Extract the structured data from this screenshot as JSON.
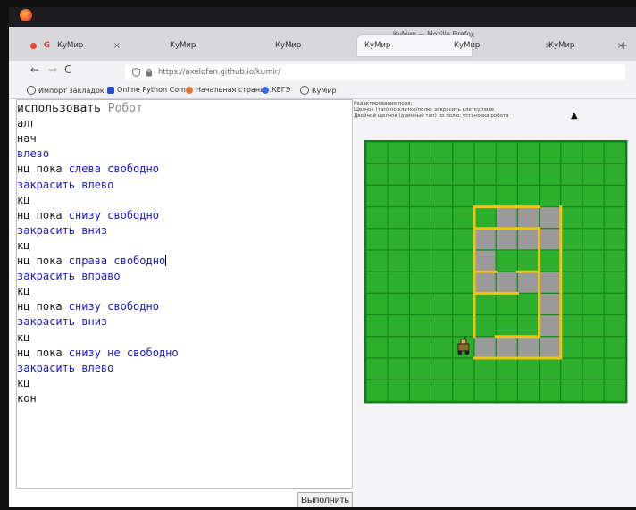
{
  "browser": {
    "window_title": "КуМир — Mozilla Firefox",
    "tabs": [
      {
        "g": "G",
        "label": "КуМир",
        "close": "×"
      },
      {
        "label": "КуМир",
        "close": "×"
      },
      {
        "label": "КуМир",
        "close": "×"
      },
      {
        "label": "КуМир",
        "close": ""
      },
      {
        "label": "КуМир",
        "close": "×"
      },
      {
        "label": "КуМир",
        "close": "×"
      }
    ],
    "new_tab": "+",
    "nav": {
      "back": "←",
      "forward": "→",
      "reload": "C"
    },
    "url": "https://axelofan.github.io/kumir/",
    "bookmarks": [
      "Импорт закладок...",
      "Online Python Com...",
      "Начальная страни...",
      "КЕГЭ",
      "КуМир"
    ]
  },
  "editor": {
    "lines": [
      [
        {
          "t": "использовать ",
          "c": "k"
        },
        {
          "t": "Робот",
          "c": "g"
        }
      ],
      [
        {
          "t": "алг",
          "c": "k"
        }
      ],
      [
        {
          "t": "нач",
          "c": "k"
        }
      ],
      [
        {
          "t": "влево",
          "c": "b"
        }
      ],
      [
        {
          "t": "нц пока ",
          "c": "k"
        },
        {
          "t": "слева свободно",
          "c": "b"
        }
      ],
      [
        {
          "t": "закрасить влево",
          "c": "b"
        }
      ],
      [
        {
          "t": "кц",
          "c": "k"
        }
      ],
      [
        {
          "t": "нц пока ",
          "c": "k"
        },
        {
          "t": "снизу свободно",
          "c": "b"
        }
      ],
      [
        {
          "t": "закрасить вниз",
          "c": "b"
        }
      ],
      [
        {
          "t": "кц",
          "c": "k"
        }
      ],
      [
        {
          "t": "нц пока ",
          "c": "k"
        },
        {
          "t": "справа свободно",
          "c": "b"
        }
      ],
      [
        {
          "t": "закрасить вправо",
          "c": "b"
        }
      ],
      [
        {
          "t": "кц",
          "c": "k"
        }
      ],
      [
        {
          "t": "нц пока ",
          "c": "k"
        },
        {
          "t": "снизу свободно",
          "c": "b"
        }
      ],
      [
        {
          "t": "закрасить вниз",
          "c": "b"
        }
      ],
      [
        {
          "t": "кц",
          "c": "k"
        }
      ],
      [
        {
          "t": "нц пока ",
          "c": "k"
        },
        {
          "t": "снизу не свободно",
          "c": "b"
        }
      ],
      [
        {
          "t": "закрасить влево",
          "c": "b"
        }
      ],
      [
        {
          "t": "кц",
          "c": "k"
        }
      ],
      [
        {
          "t": "кон",
          "c": "k"
        }
      ]
    ],
    "cursor_line": 10
  },
  "run_button": "Выполнить",
  "field": {
    "hint_lines": [
      "Редактирование поля:",
      "Щелчок (тап) по клетке/полю: закрасить клетку/поле",
      "Двойной щелчок (длинный тап) по полю: установка робота"
    ],
    "rows": 12,
    "cols": 12,
    "colors": {
      "grass": "#2fb12f",
      "painted": "#9a9a9a",
      "grid": "#168a16",
      "wall": "#f2c418",
      "border": "#0e7a1e"
    },
    "painted_cells": [
      [
        3,
        6
      ],
      [
        3,
        7
      ],
      [
        3,
        8
      ],
      [
        4,
        5
      ],
      [
        4,
        6
      ],
      [
        4,
        7
      ],
      [
        4,
        8
      ],
      [
        5,
        5
      ],
      [
        6,
        5
      ],
      [
        6,
        6
      ],
      [
        6,
        7
      ],
      [
        6,
        8
      ],
      [
        7,
        8
      ],
      [
        8,
        8
      ],
      [
        9,
        5
      ],
      [
        9,
        6
      ],
      [
        9,
        7
      ],
      [
        9,
        8
      ]
    ],
    "walls": [
      {
        "r1": 3,
        "c1": 5,
        "r2": 3,
        "c2": 8
      },
      {
        "r1": 4,
        "c1": 5,
        "r2": 4,
        "c2": 8
      },
      {
        "r1": 3,
        "c1": 5,
        "r2": 9,
        "c2": 5
      },
      {
        "r1": 4,
        "c1": 8,
        "r2": 7,
        "c2": 8
      },
      {
        "r1": 6,
        "c1": 8,
        "r2": 6,
        "c2": 7
      },
      {
        "r1": 7,
        "c1": 7,
        "r2": 7,
        "c2": 5
      },
      {
        "r1": 6,
        "c1": 5,
        "r2": 6,
        "c2": 6
      },
      {
        "r1": 10,
        "c1": 5,
        "r2": 10,
        "c2": 9
      },
      {
        "r1": 3,
        "c1": 9,
        "r2": 10,
        "c2": 9
      },
      {
        "r1": 9,
        "c1": 6,
        "r2": 9,
        "c2": 8
      },
      {
        "r1": 7,
        "c1": 8,
        "r2": 9,
        "c2": 8
      }
    ],
    "robot": {
      "row": 9,
      "col": 4
    }
  }
}
